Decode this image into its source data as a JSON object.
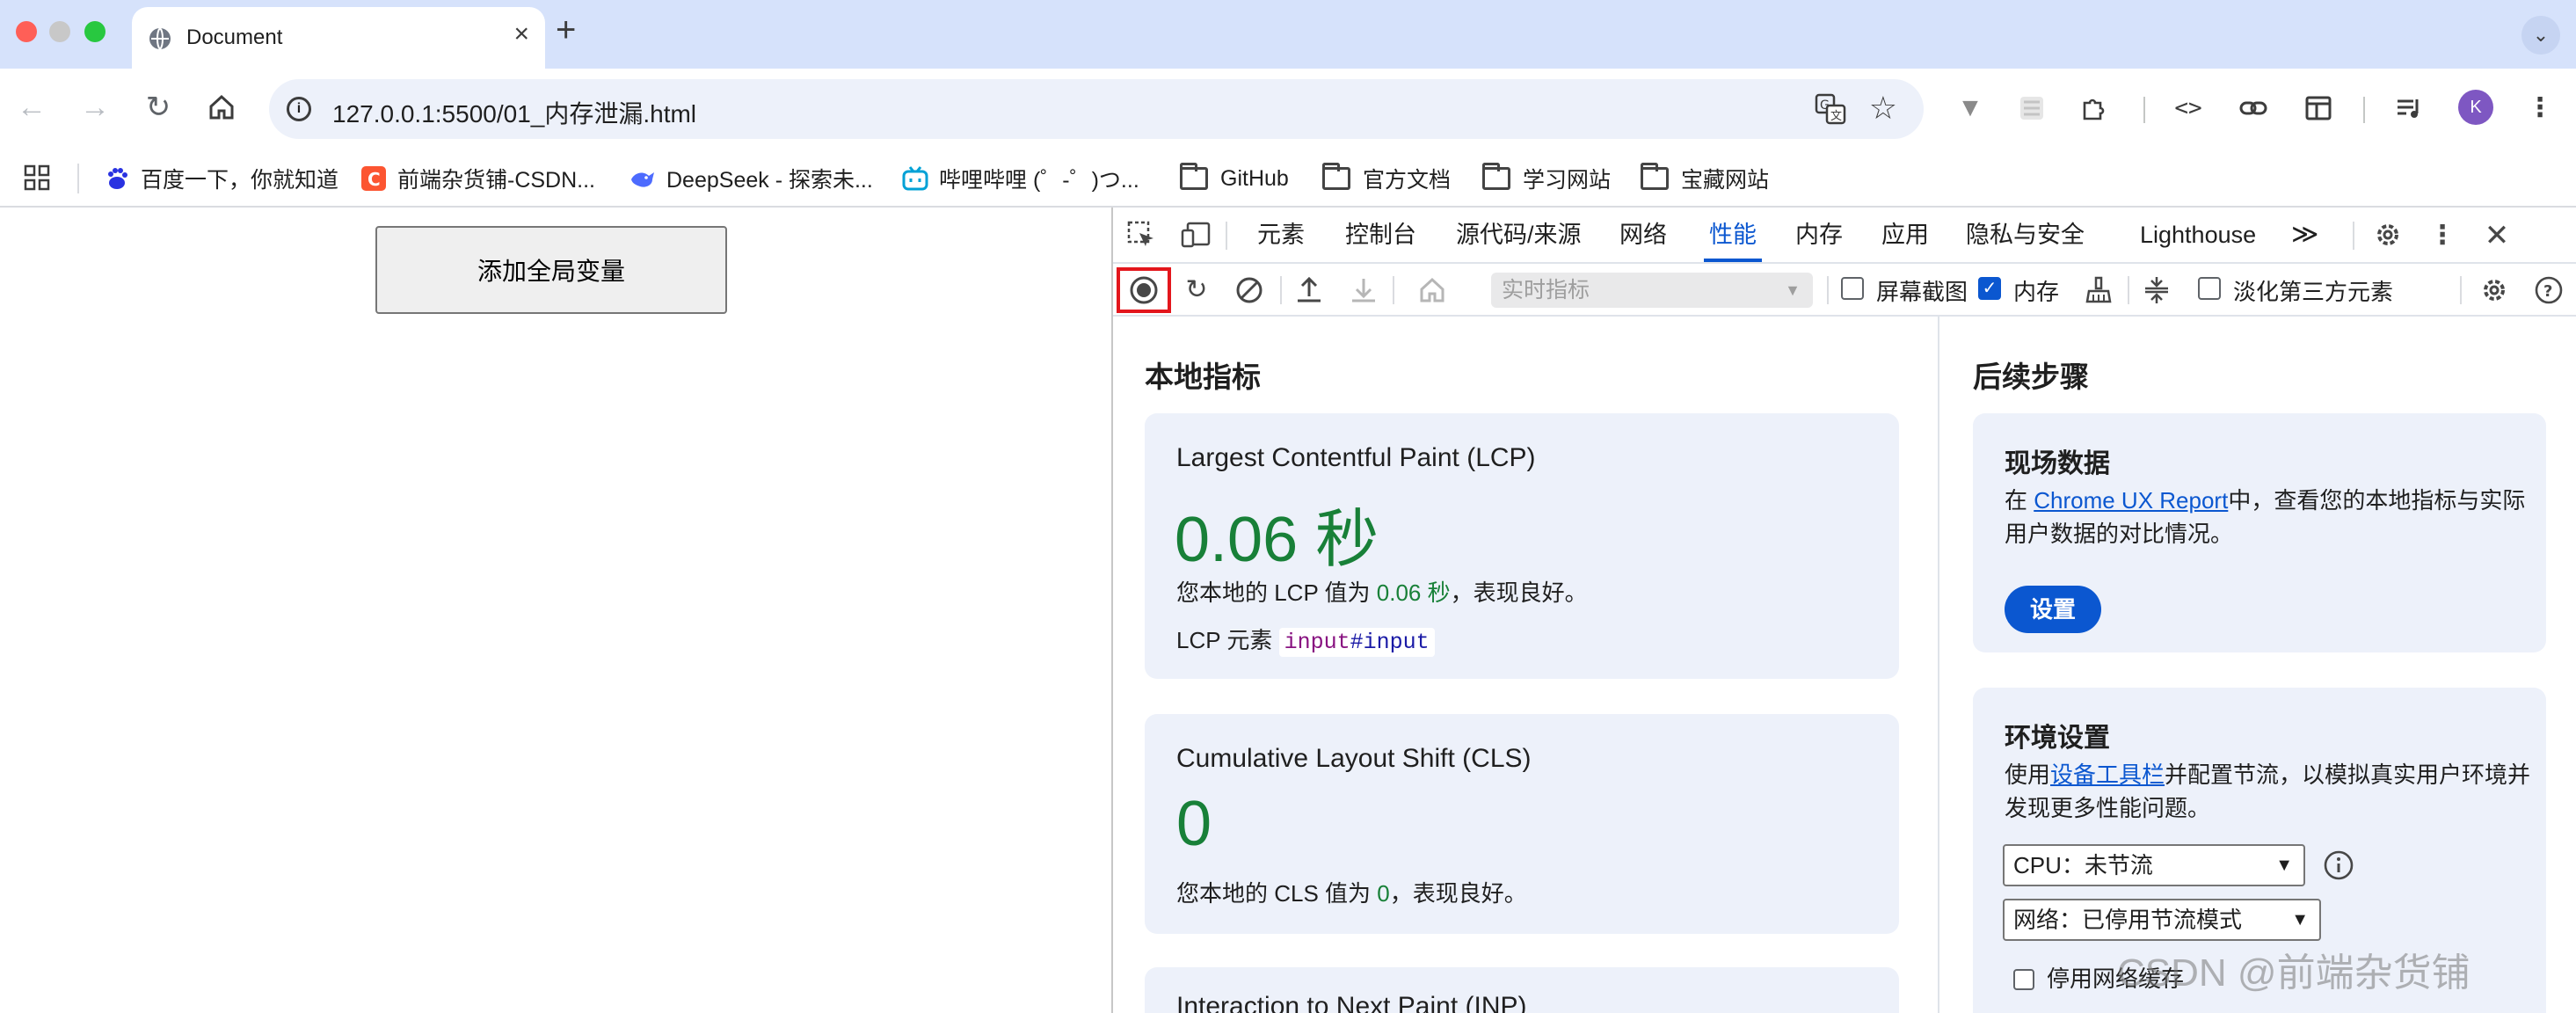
{
  "browser": {
    "tab_title": "Document",
    "new_tab": "+",
    "url": "127.0.0.1:5500/01_内存泄漏.html",
    "avatar_letter": "K"
  },
  "bookmarks": [
    {
      "label": "百度一下，你就知道",
      "icon": "baidu-icon",
      "color": "#2932e1"
    },
    {
      "label": "前端杂货铺-CSDN...",
      "icon": "csdn-icon",
      "color": "#fc5531"
    },
    {
      "label": "DeepSeek - 探索未...",
      "icon": "deepseek-icon",
      "color": "#4d6bfe"
    },
    {
      "label": "哔哩哔哩 (゜-゜)つ...",
      "icon": "bilibili-icon",
      "color": "#00a1d6"
    },
    {
      "label": "GitHub",
      "icon": "folder-icon"
    },
    {
      "label": "官方文档",
      "icon": "folder-icon"
    },
    {
      "label": "学习网站",
      "icon": "folder-icon"
    },
    {
      "label": "宝藏网站",
      "icon": "folder-icon"
    }
  ],
  "page": {
    "add_global_button": "添加全局变量"
  },
  "devtools": {
    "tabs": [
      "元素",
      "控制台",
      "源代码/来源",
      "网络",
      "性能",
      "内存",
      "应用",
      "隐私与安全",
      "Lighthouse"
    ],
    "active_tab": "性能",
    "more_tabs": "≫",
    "toolbar": {
      "metric_select": "实时指标",
      "screenshot_label": "屏幕截图",
      "screenshot_checked": false,
      "memory_label": "内存",
      "memory_checked": true,
      "dim_third_party_label": "淡化第三方元素",
      "dim_third_party_checked": false
    },
    "local_metrics": {
      "title": "本地指标",
      "lcp": {
        "name": "Largest Contentful Paint (LCP)",
        "value": "0.06 秒",
        "desc_prefix": "您本地的 LCP 值为 ",
        "desc_value": "0.06 秒",
        "desc_suffix": "，表现良好。",
        "element_label": "LCP 元素",
        "element_tag": "input",
        "element_id": "#input"
      },
      "cls": {
        "name": "Cumulative Layout Shift (CLS)",
        "value": "0",
        "desc_prefix": "您本地的 CLS 值为 ",
        "desc_value": "0",
        "desc_suffix": "，表现良好。"
      },
      "inp_partial": "Interaction to Next Paint (INP)"
    },
    "next_steps": {
      "title": "后续步骤",
      "field_data": {
        "title": "现场数据",
        "text_before": "在 ",
        "link": "Chrome UX Report",
        "text_after": "中，查看您的本地指标与实际用户数据的对比情况。",
        "button": "设置"
      },
      "env": {
        "title": "环境设置",
        "text_before": "使用",
        "link": "设备工具栏",
        "text_after": "并配置节流，以模拟真实用户环境并发现更多性能问题。",
        "cpu_select": "CPU：未节流",
        "network_select": "网络：已停用节流模式",
        "disable_cache_label": "停用网络缓存"
      }
    }
  },
  "watermark": "CSDN @前端杂货铺",
  "colors": {
    "accent": "#0b57d0",
    "good": "#188038",
    "record_highlight": "#e3161c"
  }
}
